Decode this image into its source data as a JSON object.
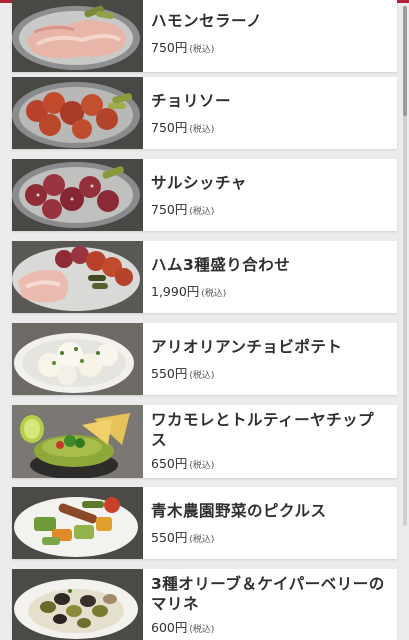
{
  "menu": {
    "items": [
      {
        "name": "ハモンセラーノ",
        "price": "750円",
        "tax": "(税込)",
        "photo": "jamon-plate-photo"
      },
      {
        "name": "チョリソー",
        "price": "750円",
        "tax": "(税込)",
        "photo": "chorizo-plate-photo"
      },
      {
        "name": "サルシッチャ",
        "price": "750円",
        "tax": "(税込)",
        "photo": "salsiccia-plate-photo"
      },
      {
        "name": "ハム3種盛り合わせ",
        "price": "1,990円",
        "tax": "(税込)",
        "photo": "ham-assortment-photo"
      },
      {
        "name": "アリオリアンチョビポテト",
        "price": "550円",
        "tax": "(税込)",
        "photo": "potato-plate-photo"
      },
      {
        "name": "ワカモレとトルティーヤチップス",
        "price": "650円",
        "tax": "(税込)",
        "photo": "guacamole-photo"
      },
      {
        "name": "青木農園野菜のピクルス",
        "price": "550円",
        "tax": "(税込)",
        "photo": "pickles-photo"
      },
      {
        "name": "3種オリーブ＆ケイパーベリーのマリネ",
        "price": "600円",
        "tax": "(税込)",
        "photo": "olive-marinade-photo"
      }
    ]
  },
  "colors": {
    "accent": "#b2223b",
    "background": "#ececec",
    "card": "#ffffff",
    "text": "#2f2f2f"
  }
}
